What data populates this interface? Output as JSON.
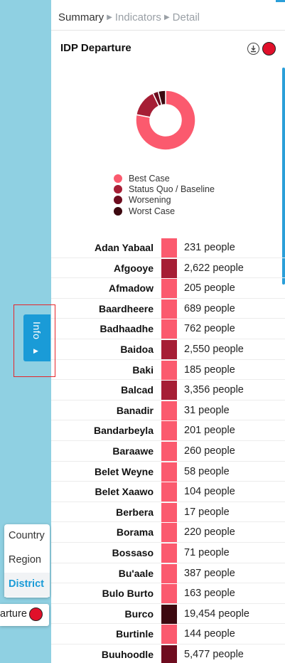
{
  "breadcrumb": {
    "current": "Summary",
    "items": [
      "Indicators",
      "Detail"
    ]
  },
  "panel": {
    "title": "IDP Departure",
    "download_icon": "download-icon",
    "status_color": "#e0102a"
  },
  "legend": [
    {
      "label": "Best Case",
      "color": "#fb5a6e"
    },
    {
      "label": "Status Quo / Baseline",
      "color": "#a61e35"
    },
    {
      "label": "Worsening",
      "color": "#6e0c1f"
    },
    {
      "label": "Worst Case",
      "color": "#3d0910"
    }
  ],
  "chart_data": {
    "type": "pie",
    "donut": true,
    "title": "",
    "categories": [
      "Best Case",
      "Status Quo / Baseline",
      "Worsening",
      "Worst Case"
    ],
    "values": [
      78,
      15,
      3,
      4
    ],
    "colors": [
      "#fb5a6e",
      "#a61e35",
      "#6e0c1f",
      "#3d0910"
    ],
    "legend_position": "bottom"
  },
  "districts": [
    {
      "name": "Adan Yabaal",
      "value": "231 people",
      "color": "#fb5a6e"
    },
    {
      "name": "Afgooye",
      "value": "2,622 people",
      "color": "#a61e35"
    },
    {
      "name": "Afmadow",
      "value": "205 people",
      "color": "#fb5a6e"
    },
    {
      "name": "Baardheere",
      "value": "689 people",
      "color": "#fb5a6e"
    },
    {
      "name": "Badhaadhe",
      "value": "762 people",
      "color": "#fb5a6e"
    },
    {
      "name": "Baidoa",
      "value": "2,550 people",
      "color": "#a61e35"
    },
    {
      "name": "Baki",
      "value": "185 people",
      "color": "#fb5a6e"
    },
    {
      "name": "Balcad",
      "value": "3,356 people",
      "color": "#a61e35"
    },
    {
      "name": "Banadir",
      "value": "31 people",
      "color": "#fb5a6e"
    },
    {
      "name": "Bandarbeyla",
      "value": "201 people",
      "color": "#fb5a6e"
    },
    {
      "name": "Baraawe",
      "value": "260 people",
      "color": "#fb5a6e"
    },
    {
      "name": "Belet Weyne",
      "value": "58 people",
      "color": "#fb5a6e"
    },
    {
      "name": "Belet Xaawo",
      "value": "104 people",
      "color": "#fb5a6e"
    },
    {
      "name": "Berbera",
      "value": "17 people",
      "color": "#fb5a6e"
    },
    {
      "name": "Borama",
      "value": "220 people",
      "color": "#fb5a6e"
    },
    {
      "name": "Bossaso",
      "value": "71 people",
      "color": "#fb5a6e"
    },
    {
      "name": "Bu'aale",
      "value": "387 people",
      "color": "#fb5a6e"
    },
    {
      "name": "Bulo Burto",
      "value": "163 people",
      "color": "#fb5a6e"
    },
    {
      "name": "Burco",
      "value": "19,454 people",
      "color": "#3d0910"
    },
    {
      "name": "Burtinle",
      "value": "144 people",
      "color": "#fb5a6e"
    },
    {
      "name": "Buuhoodle",
      "value": "5,477 people",
      "color": "#6e0c1f"
    }
  ],
  "info_tab": {
    "label": "Info"
  },
  "levels": {
    "items": [
      "Country",
      "Region",
      "District"
    ],
    "active": "District"
  },
  "layer_chip": {
    "label": "arture",
    "color": "#e0102a"
  }
}
